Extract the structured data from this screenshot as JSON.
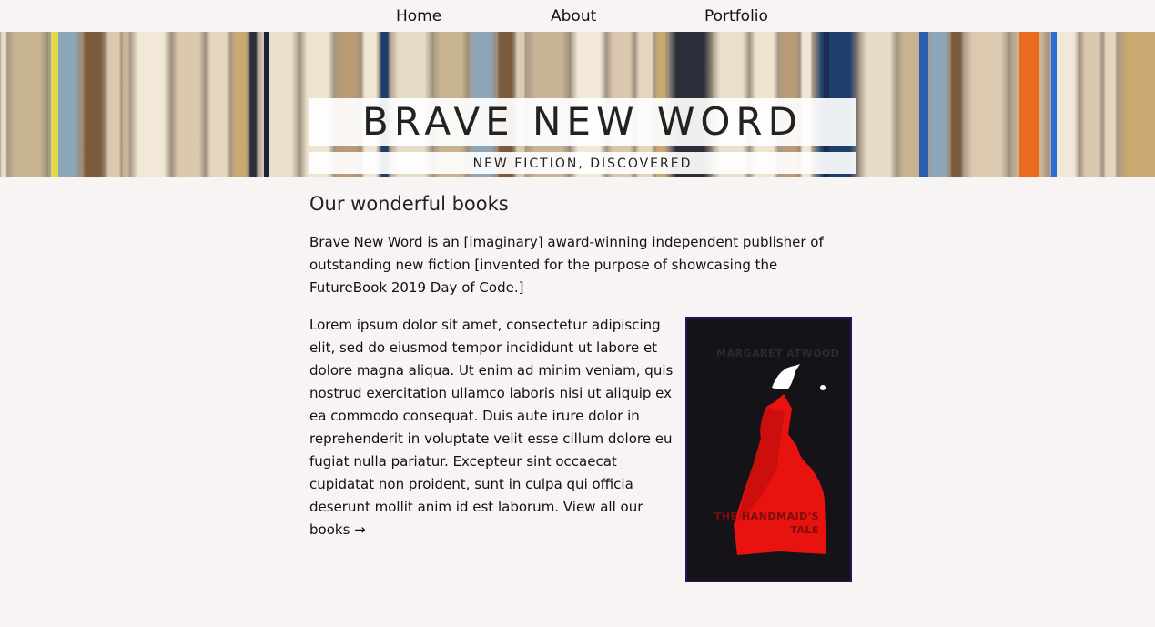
{
  "nav": {
    "home": "Home",
    "about": "About",
    "portfolio": "Portfolio"
  },
  "hero": {
    "title": "BRAVE NEW WORD",
    "subtitle": "NEW FICTION, DISCOVERED"
  },
  "main": {
    "heading": "Our wonderful books",
    "intro": "Brave New Word is an [imaginary] award-winning independent publisher of outstanding new fiction [invented for the purpose of showcasing the FutureBook 2019 Day of Code.]",
    "lorem": "Lorem ipsum dolor sit amet, consectetur adipiscing elit, sed do eiusmod tempor incididunt ut labore et dolore magna aliqua. Ut enim ad minim veniam, quis nostrud exercitation ullamco laboris nisi ut aliquip ex ea commodo consequat. Duis aute irure dolor in reprehenderit in voluptate velit esse cillum dolore eu fugiat nulla pariatur. Excepteur sint occaecat cupidatat non proident, sunt in culpa qui officia deserunt mollit anim id est laborum.",
    "view_all": "View all our books →"
  },
  "book": {
    "author": "MARGARET ATWOOD",
    "title": "THE HANDMAID'S TALE"
  },
  "colors": {
    "background": "#f8f4f3",
    "cover_bg": "#151318",
    "cover_border": "#26125f",
    "cloak_red": "#e8120f"
  }
}
